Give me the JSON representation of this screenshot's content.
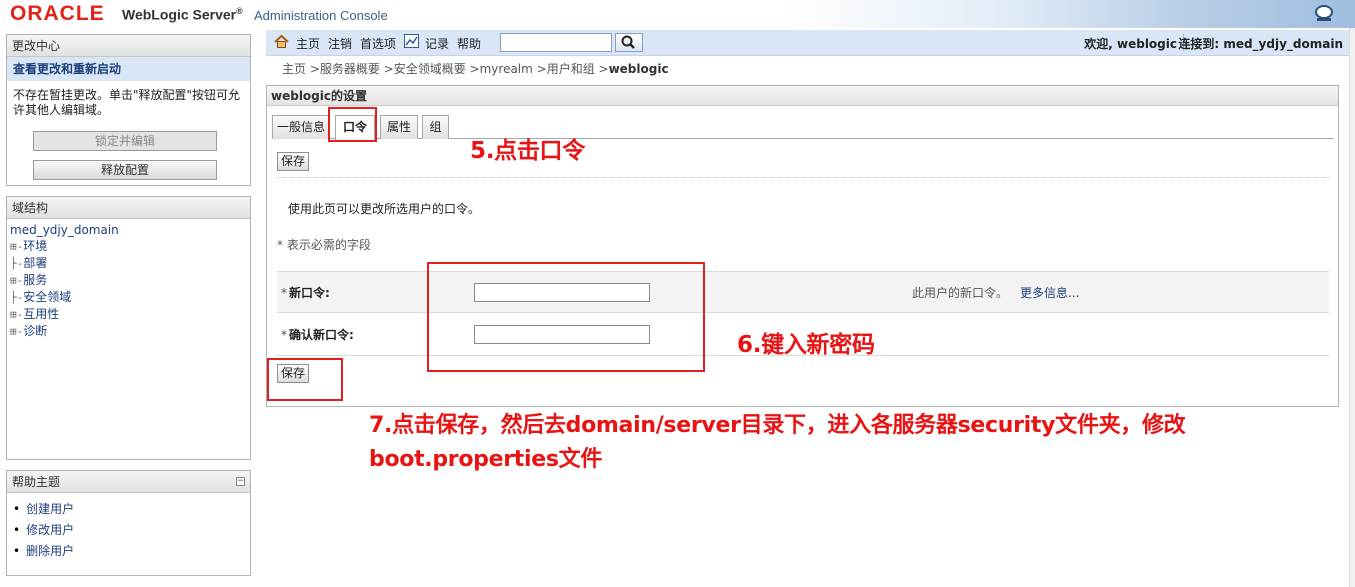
{
  "banner": {
    "logo": "ORACLE",
    "product": "WebLogic Server",
    "registered": "®",
    "subtitle": "Administration Console"
  },
  "change_center": {
    "title": "更改中心",
    "view_changes": "查看更改和重新启动",
    "note": "不存在暂挂更改。单击\"释放配置\"按钮可允许其他人编辑域。",
    "lock_edit": "锁定并编辑",
    "release": "释放配置"
  },
  "domain_structure": {
    "title": "域结构",
    "root": "med_ydjy_domain",
    "nodes": [
      {
        "prefix": "⊞-",
        "label": "环境"
      },
      {
        "prefix": "├-",
        "label": "部署"
      },
      {
        "prefix": "⊞-",
        "label": "服务"
      },
      {
        "prefix": "├-",
        "label": "安全领域"
      },
      {
        "prefix": "⊞-",
        "label": "互用性"
      },
      {
        "prefix": "⊞-",
        "label": "诊断"
      }
    ]
  },
  "help_topics": {
    "title": "帮助主题",
    "collapse": "−",
    "items": [
      "创建用户",
      "修改用户",
      "删除用户"
    ]
  },
  "toolbar": {
    "home": "主页",
    "logout": "注销",
    "preferences": "首选项",
    "record": "记录",
    "help": "帮助",
    "search_value": "",
    "welcome": "欢迎, weblogic",
    "connected": "连接到: med_ydjy_domain"
  },
  "breadcrumb": {
    "trail": "主页 >服务器概要 >安全领域概要 >myrealm >用户和组 >",
    "current": "weblogic"
  },
  "settings": {
    "title": "weblogic的设置",
    "tabs": [
      "一般信息",
      "口令",
      "属性",
      "组"
    ],
    "active_tab": "口令",
    "save": "保存",
    "description": "使用此页可以更改所选用户的口令。",
    "required_note": "* 表示必需的字段",
    "fields": [
      {
        "label": "新口令:",
        "value": ""
      },
      {
        "label": "确认新口令:",
        "value": ""
      }
    ],
    "hint": "此用户的新口令。",
    "more_info": "更多信息..."
  },
  "annotations": {
    "step5": "5.点击口令",
    "step6": "6.键入新密码",
    "step7_line1": "7.点击保存，然后去domain/server目录下，进入各服务器security文件夹，修改",
    "step7_line2": "boot.properties文件"
  },
  "colors": {
    "oracle_red": "#e2231a",
    "annotation_red": "#e81313",
    "toolbar_blue": "#d9e6f5",
    "link_blue": "#1e3f7c"
  }
}
